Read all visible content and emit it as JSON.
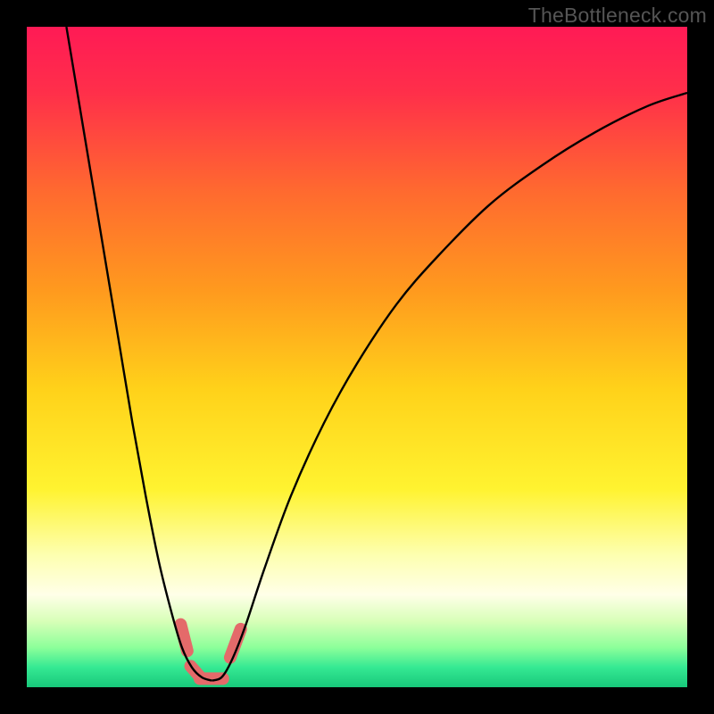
{
  "watermark": "TheBottleneck.com",
  "chart_data": {
    "type": "line",
    "title": "",
    "xlabel": "",
    "ylabel": "",
    "xlim": [
      0,
      100
    ],
    "ylim": [
      0,
      100
    ],
    "gradient_stops": [
      {
        "offset": 0.0,
        "color": "#ff1a55"
      },
      {
        "offset": 0.1,
        "color": "#ff2f4a"
      },
      {
        "offset": 0.25,
        "color": "#ff6a2f"
      },
      {
        "offset": 0.4,
        "color": "#ff9a1e"
      },
      {
        "offset": 0.55,
        "color": "#ffd21a"
      },
      {
        "offset": 0.7,
        "color": "#fff330"
      },
      {
        "offset": 0.8,
        "color": "#fdffb0"
      },
      {
        "offset": 0.86,
        "color": "#ffffe8"
      },
      {
        "offset": 0.9,
        "color": "#d8ffb8"
      },
      {
        "offset": 0.94,
        "color": "#8cff9a"
      },
      {
        "offset": 0.97,
        "color": "#35e993"
      },
      {
        "offset": 1.0,
        "color": "#18c87a"
      }
    ],
    "series": [
      {
        "name": "left-curve",
        "stroke": "#000000",
        "points": [
          {
            "x": 6.0,
            "y": 100.0
          },
          {
            "x": 7.0,
            "y": 94.0
          },
          {
            "x": 8.5,
            "y": 85.0
          },
          {
            "x": 10.0,
            "y": 76.0
          },
          {
            "x": 12.0,
            "y": 64.0
          },
          {
            "x": 14.0,
            "y": 52.0
          },
          {
            "x": 16.0,
            "y": 40.0
          },
          {
            "x": 18.0,
            "y": 29.0
          },
          {
            "x": 20.0,
            "y": 19.0
          },
          {
            "x": 22.0,
            "y": 11.0
          },
          {
            "x": 23.5,
            "y": 6.0
          },
          {
            "x": 25.0,
            "y": 3.0
          },
          {
            "x": 26.5,
            "y": 1.5
          },
          {
            "x": 28.0,
            "y": 1.0
          }
        ]
      },
      {
        "name": "right-curve",
        "stroke": "#000000",
        "points": [
          {
            "x": 28.0,
            "y": 1.0
          },
          {
            "x": 29.5,
            "y": 1.5
          },
          {
            "x": 31.0,
            "y": 4.0
          },
          {
            "x": 33.0,
            "y": 9.0
          },
          {
            "x": 36.0,
            "y": 18.0
          },
          {
            "x": 40.0,
            "y": 29.0
          },
          {
            "x": 45.0,
            "y": 40.0
          },
          {
            "x": 50.0,
            "y": 49.0
          },
          {
            "x": 56.0,
            "y": 58.0
          },
          {
            "x": 62.0,
            "y": 65.0
          },
          {
            "x": 70.0,
            "y": 73.0
          },
          {
            "x": 78.0,
            "y": 79.0
          },
          {
            "x": 86.0,
            "y": 84.0
          },
          {
            "x": 94.0,
            "y": 88.0
          },
          {
            "x": 100.0,
            "y": 90.0
          }
        ]
      }
    ],
    "highlight_strokes": [
      {
        "name": "highlight-left-upper",
        "color": "#e46a6a",
        "width": 14,
        "points": [
          {
            "x": 23.3,
            "y": 9.5
          },
          {
            "x": 24.3,
            "y": 5.5
          }
        ]
      },
      {
        "name": "highlight-left-lower",
        "color": "#e46a6a",
        "width": 14,
        "points": [
          {
            "x": 24.8,
            "y": 3.2
          },
          {
            "x": 26.2,
            "y": 1.6
          }
        ]
      },
      {
        "name": "highlight-bottom",
        "color": "#e46a6a",
        "width": 14,
        "points": [
          {
            "x": 26.2,
            "y": 1.3
          },
          {
            "x": 29.7,
            "y": 1.3
          }
        ]
      },
      {
        "name": "highlight-right",
        "color": "#e46a6a",
        "width": 14,
        "points": [
          {
            "x": 30.8,
            "y": 4.5
          },
          {
            "x": 32.4,
            "y": 8.8
          }
        ]
      }
    ]
  }
}
